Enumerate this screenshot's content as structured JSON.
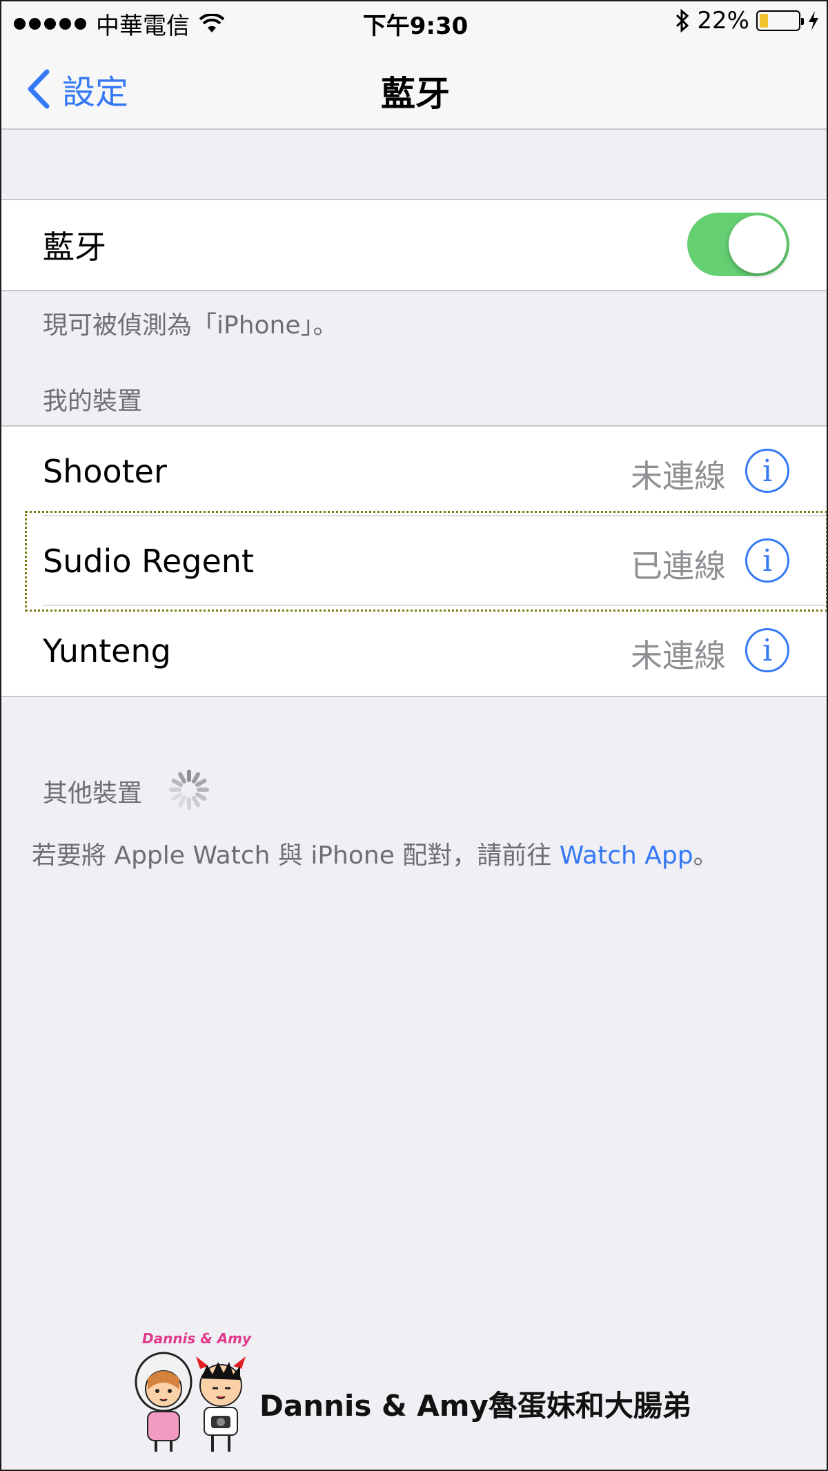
{
  "status_bar": {
    "carrier": "中華電信",
    "time": "下午9:30",
    "battery_percent": "22%",
    "battery_level": 0.22
  },
  "nav": {
    "back_label": "設定",
    "title": "藍牙"
  },
  "bluetooth_toggle": {
    "label": "藍牙",
    "on": true,
    "discoverable_text": "現可被偵測為「iPhone」。"
  },
  "my_devices": {
    "header": "我的裝置",
    "items": [
      {
        "name": "Shooter",
        "status": "未連線"
      },
      {
        "name": "Sudio Regent",
        "status": "已連線"
      },
      {
        "name": "Yunteng",
        "status": "未連線"
      }
    ]
  },
  "other_devices": {
    "header": "其他裝置",
    "pairing_text_prefix": "若要將 Apple Watch 與 iPhone 配對，請前往 ",
    "pairing_link": "Watch App",
    "pairing_text_suffix": "。"
  },
  "watermark": {
    "logo_text": "Dannis & Amy",
    "caption": "Dannis & Amy魯蛋妹和大腸弟"
  },
  "colors": {
    "accent": "#3478f6",
    "toggle_on": "#65d072",
    "background": "#efeff4"
  }
}
